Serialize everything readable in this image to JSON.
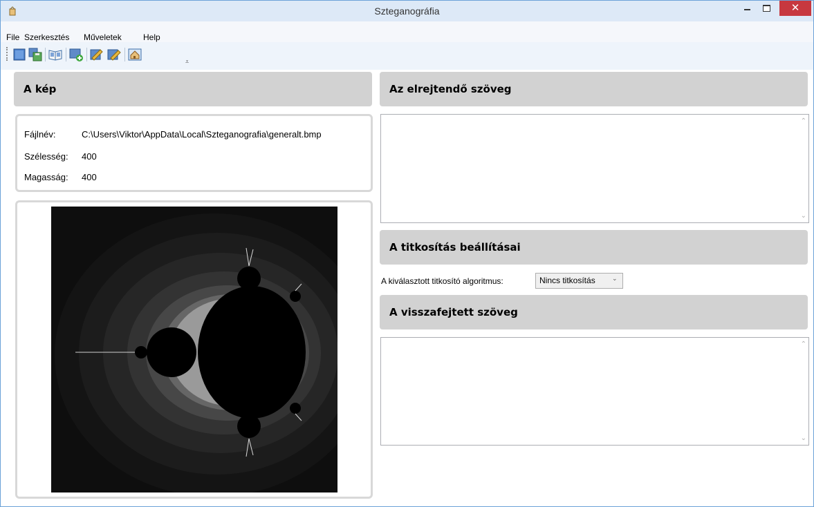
{
  "window": {
    "title": "Szteganográfia",
    "close_symbol": "✕",
    "icons": [
      "app-icon",
      "minimize-icon",
      "maximize-icon",
      "close-icon"
    ]
  },
  "menu": {
    "items": [
      {
        "label": "File"
      },
      {
        "label": "Szerkesztés"
      },
      {
        "label": "Műveletek"
      },
      {
        "label": "Help"
      }
    ]
  },
  "toolbar": {
    "icons": [
      "new-icon",
      "save-icon",
      "open-book-icon",
      "add-image-icon",
      "edit-icon",
      "encode-icon",
      "home-icon"
    ],
    "overflow_symbol": "⩡"
  },
  "image_panel": {
    "header": "A kép",
    "filename_label": "Fájlnév:",
    "filename_value": "C:\\Users\\Viktor\\AppData\\Local\\Szteganografia\\generalt.bmp",
    "width_label": "Szélesség:",
    "width_value": "400",
    "height_label": "Magasság:",
    "height_value": "400"
  },
  "hidden_text_panel": {
    "header": "Az elrejtendő szöveg",
    "value": ""
  },
  "encryption_panel": {
    "header": "A titkosítás beállításai",
    "algorithm_label": "A kiválasztott titkosító algoritmus:",
    "algorithm_selected": "Nincs titkosítás"
  },
  "decoded_text_panel": {
    "header": "A visszafejtett szöveg",
    "value": ""
  },
  "colors": {
    "titlebar": "#dde9f7",
    "close_button": "#c7383f",
    "header_bg": "#d2d2d2",
    "toolbar_bg": "#eef4fb"
  }
}
